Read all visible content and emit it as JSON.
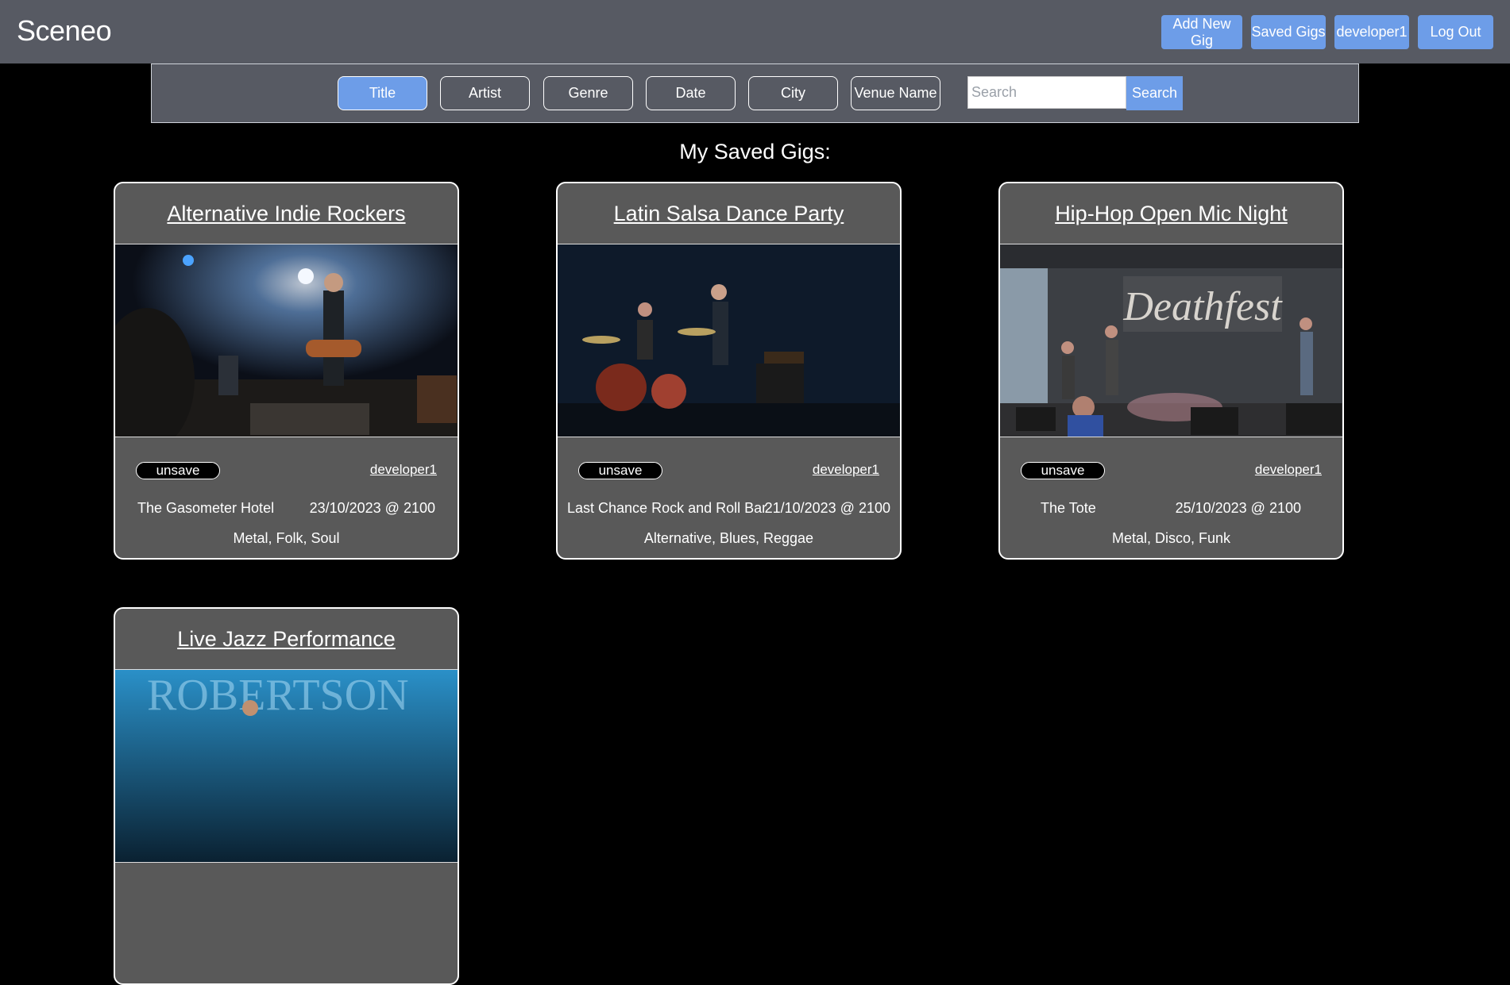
{
  "navbar": {
    "brand": "Sceneo",
    "add_new_gig": "Add New Gig",
    "saved_gigs": "Saved Gigs",
    "username": "developer1",
    "log_out": "Log Out",
    "accent_color": "#6d9de8"
  },
  "filters": {
    "options": [
      "Title",
      "Artist",
      "Genre",
      "Date",
      "City",
      "Venue Name"
    ],
    "active": "Title",
    "search_placeholder": "Search",
    "search_value": "",
    "search_button": "Search"
  },
  "page_heading": "My Saved Gigs:",
  "gigs": [
    {
      "title": "Alternative Indie Rockers",
      "unsave_label": "unsave",
      "posted_by": "developer1",
      "venue": "The Gasometer Hotel",
      "datetime": "23/10/2023 @ 2100",
      "genres": "Metal, Folk, Soul"
    },
    {
      "title": "Latin Salsa Dance Party",
      "unsave_label": "unsave",
      "posted_by": "developer1",
      "venue": "Last Chance Rock and Roll Bar",
      "datetime": "21/10/2023 @ 2100",
      "genres": "Alternative, Blues, Reggae"
    },
    {
      "title": "Hip-Hop Open Mic Night",
      "unsave_label": "unsave",
      "posted_by": "developer1",
      "venue": "The Tote",
      "datetime": "25/10/2023 @ 2100",
      "genres": "Metal, Disco, Funk"
    },
    {
      "title": "Live Jazz Performance"
    }
  ]
}
